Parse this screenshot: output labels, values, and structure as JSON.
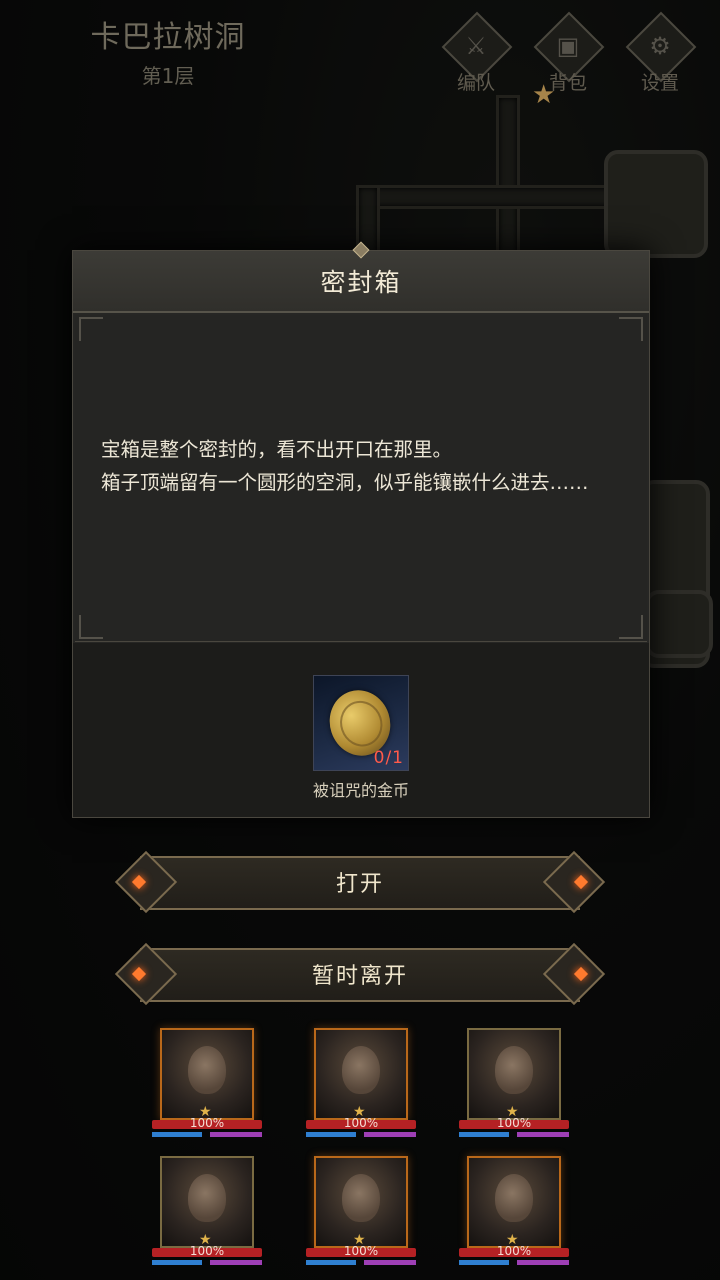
{
  "hud": {
    "location_name": "卡巴拉树洞",
    "floor": "第1层",
    "buttons": [
      {
        "label": "编队",
        "icon": "team-icon"
      },
      {
        "label": "背包",
        "icon": "bag-icon"
      },
      {
        "label": "设置",
        "icon": "gear-icon"
      }
    ]
  },
  "dialog": {
    "title": "密封箱",
    "description": "宝箱是整个密封的，看不出开口在那里。\n箱子顶端留有一个圆形的空洞，似乎能镶嵌什么进去……",
    "item": {
      "name": "被诅咒的金币",
      "count": "0/1",
      "icon": "gold-coin-icon"
    }
  },
  "actions": {
    "open_label": "打开",
    "leave_label": "暂时离开"
  },
  "heroes": [
    {
      "hp_text": "100%",
      "frame": "orange"
    },
    {
      "hp_text": "100%",
      "frame": "orange"
    },
    {
      "hp_text": "100%",
      "frame": "gold"
    },
    {
      "hp_text": "100%",
      "frame": "gold"
    },
    {
      "hp_text": "100%",
      "frame": "orange"
    },
    {
      "hp_text": "100%",
      "frame": "orange"
    }
  ]
}
